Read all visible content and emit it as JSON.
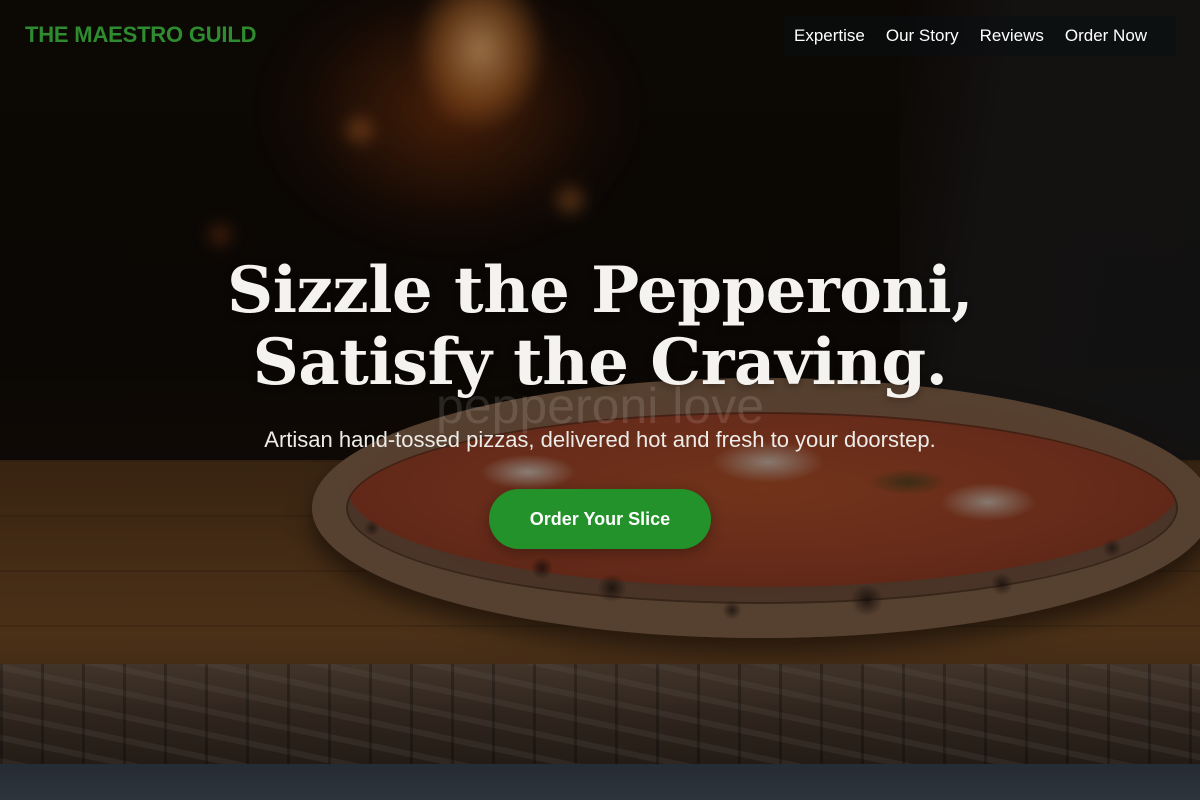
{
  "brand": {
    "name": "THE MAESTRO GUILD",
    "color": "#2e8b2f"
  },
  "nav": {
    "items": [
      {
        "label": "Expertise"
      },
      {
        "label": "Our Story"
      },
      {
        "label": "Reviews"
      },
      {
        "label": "Order Now"
      }
    ]
  },
  "hero": {
    "headline_line1": "Sizzle the Pepperoni,",
    "headline_line2": "Satisfy the Craving.",
    "watermark": "pepperoni love",
    "subtitle": "Artisan hand-tossed pizzas, delivered hot and fresh to your doorstep.",
    "cta_label": "Order Your Slice",
    "cta_color": "#23922a",
    "background_image": "pizza-oven-photo"
  }
}
